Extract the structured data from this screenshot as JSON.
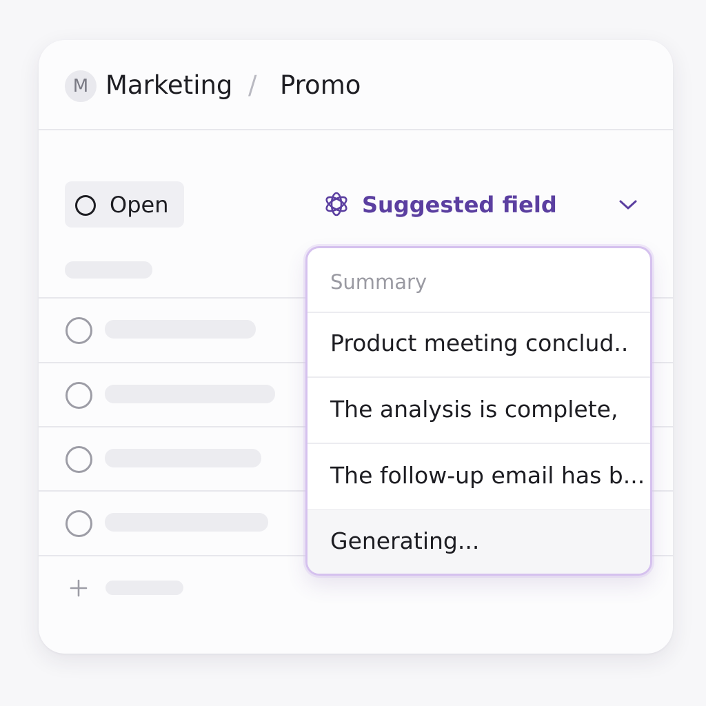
{
  "breadcrumb": {
    "avatar_initial": "M",
    "workspace": "Marketing",
    "separator": "/",
    "page": "Promo"
  },
  "status": {
    "label": "Open"
  },
  "suggested_field": {
    "label": "Suggested field",
    "icon": "sparkle-ai-icon",
    "accent_color": "#5b3fa0"
  },
  "dropdown": {
    "header": "Summary",
    "items": [
      "Product meeting conclud..",
      "The analysis is complete,",
      "The follow-up email has b...",
      "Generating..."
    ],
    "border_color": "#d5c1ee"
  },
  "rows": {
    "icons": [
      "circle-icon",
      "circle-icon",
      "circle-icon",
      "circle-icon"
    ],
    "add_icon": "plus-icon"
  }
}
